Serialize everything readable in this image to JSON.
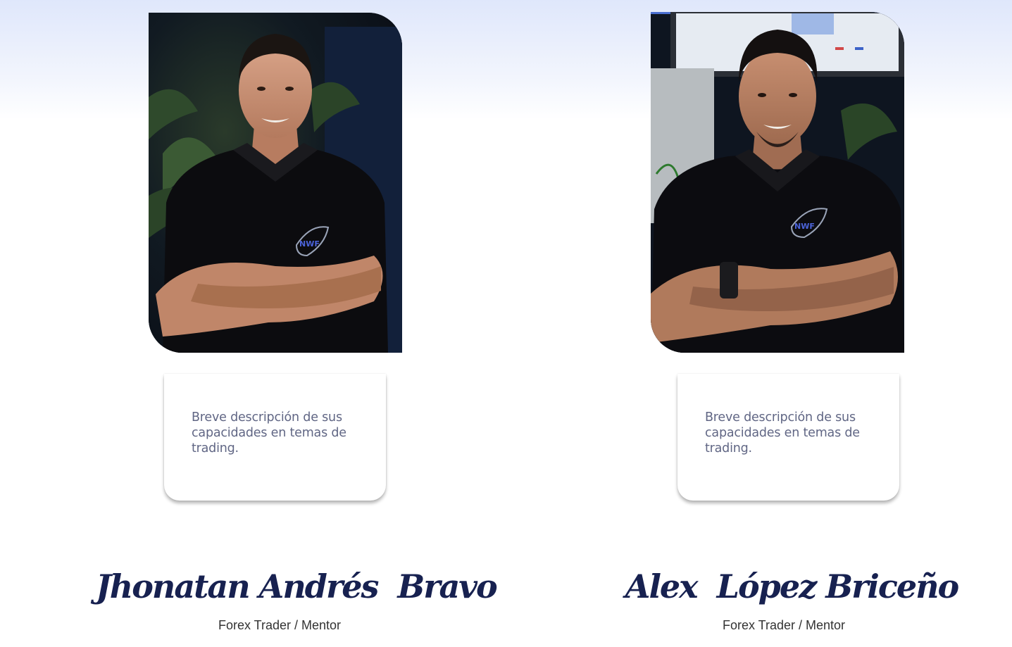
{
  "mentors": [
    {
      "photo_alt": "Jhonatan Andrés Bravo",
      "description": "Breve descripción de sus capacidades en temas de trading.",
      "name": "Jhonatan Andrés  Bravo",
      "role": "Forex Trader / Mentor"
    },
    {
      "photo_alt": "Alex López Briceño",
      "description": "Breve descripción de sus capacidades en temas de trading.",
      "name": "Alex  López Briceño",
      "role": "Forex Trader / Mentor"
    }
  ],
  "colors": {
    "name": "#172150",
    "description": "#606684",
    "role": "#333333",
    "background_top": "#dfe7fb"
  }
}
